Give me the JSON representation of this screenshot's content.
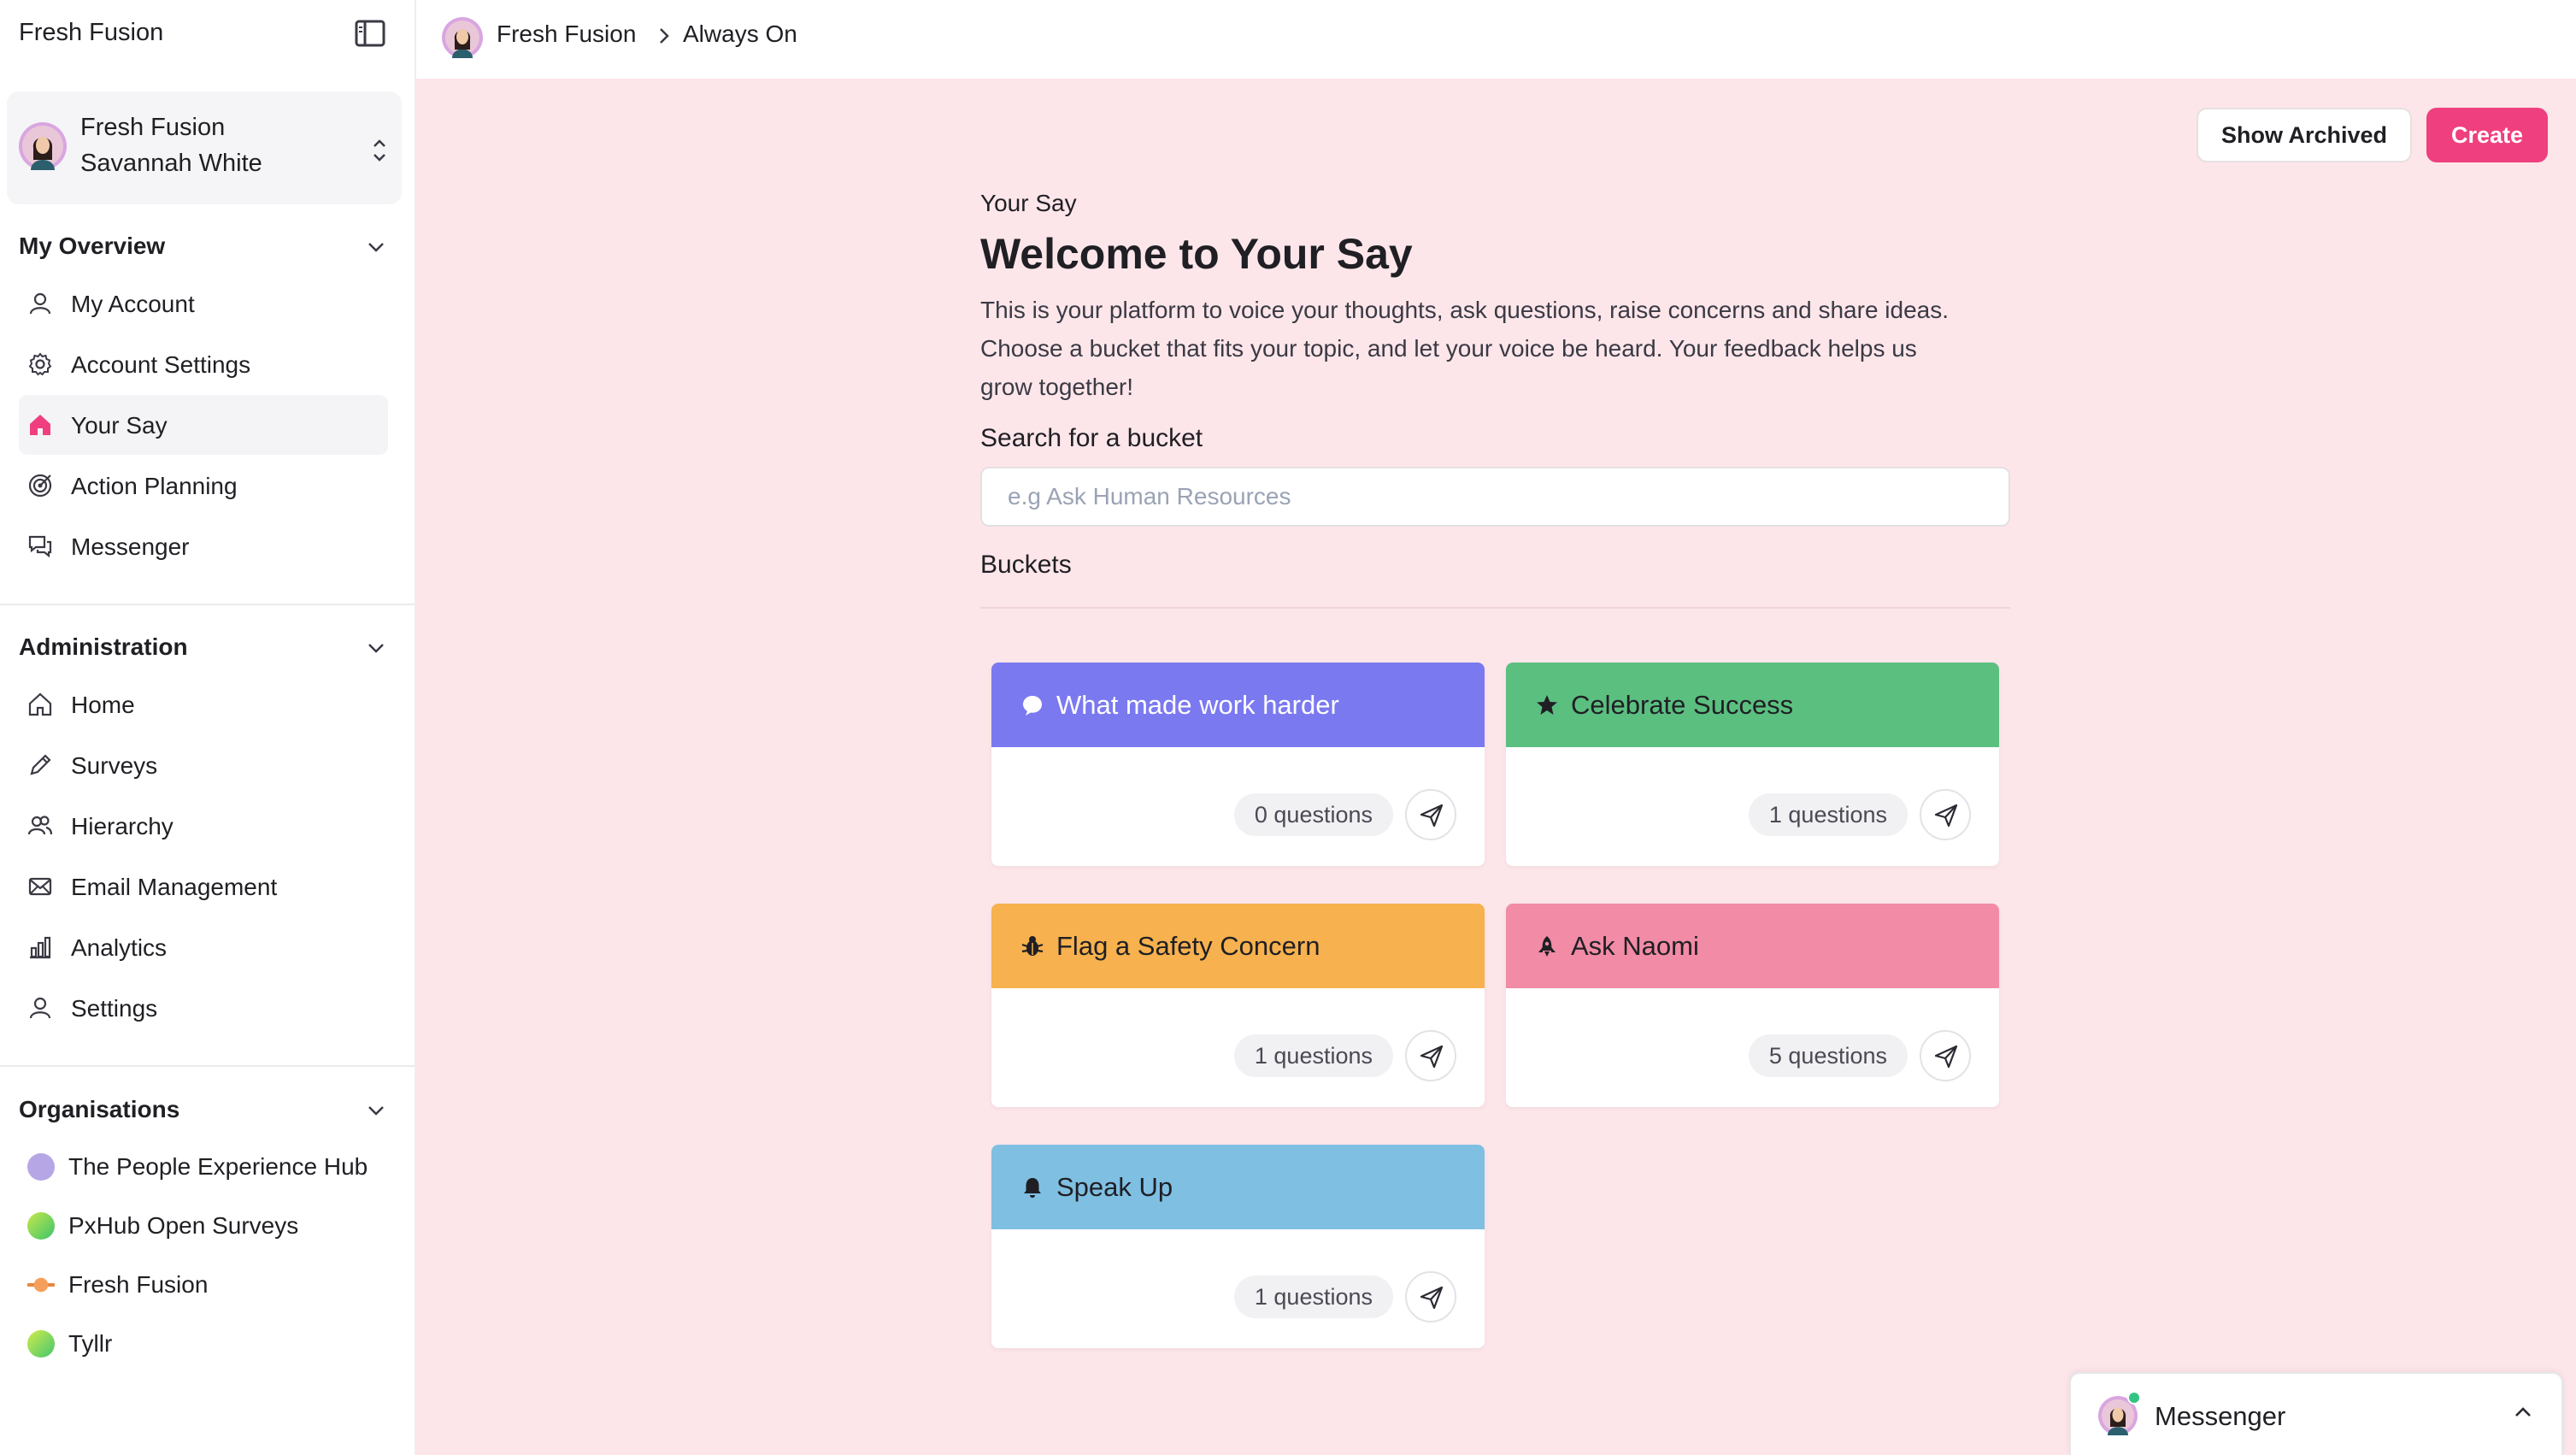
{
  "app": {
    "brand": "Fresh Fusion"
  },
  "switcher": {
    "org": "Fresh Fusion",
    "user": "Savannah White"
  },
  "sidebar": {
    "overview": {
      "title": "My Overview",
      "items": [
        {
          "label": "My Account",
          "icon": "user-icon"
        },
        {
          "label": "Account Settings",
          "icon": "gear-icon"
        },
        {
          "label": "Your Say",
          "icon": "home-icon",
          "active": true
        },
        {
          "label": "Action Planning",
          "icon": "target-icon"
        },
        {
          "label": "Messenger",
          "icon": "chat-icon"
        }
      ]
    },
    "administration": {
      "title": "Administration",
      "items": [
        {
          "label": "Home",
          "icon": "home-icon"
        },
        {
          "label": "Surveys",
          "icon": "pencil-icon"
        },
        {
          "label": "Hierarchy",
          "icon": "users-icon"
        },
        {
          "label": "Email Management",
          "icon": "mail-icon"
        },
        {
          "label": "Analytics",
          "icon": "bar-chart-icon"
        },
        {
          "label": "Settings",
          "icon": "user-cog-icon"
        }
      ]
    },
    "organisations": {
      "title": "Organisations",
      "items": [
        {
          "label": "The People Experience Hub",
          "color": "#b7a6e6"
        },
        {
          "label": "PxHub Open Surveys",
          "color": "#8fd14f"
        },
        {
          "label": "Fresh Fusion",
          "color": "#f5a05a"
        },
        {
          "label": "Tyllr",
          "color": "#9be15d"
        }
      ]
    }
  },
  "breadcrumb": {
    "items": [
      "Fresh Fusion",
      "Always On"
    ]
  },
  "toolbar": {
    "archived_label": "Show Archived",
    "create_label": "Create"
  },
  "page": {
    "eyebrow": "Your Say",
    "title": "Welcome to Your Say",
    "intro_lines": [
      "This is your platform to voice your thoughts, ask questions, raise concerns and share ideas.",
      "Choose a bucket that fits your topic, and let your voice be heard. Your feedback helps us",
      "grow together!"
    ],
    "search_label": "Search for a bucket",
    "search_placeholder": "e.g Ask Human Resources",
    "search_value": "",
    "buckets_label": "Buckets"
  },
  "buckets": [
    {
      "name": "What made work harder",
      "count": "0 questions",
      "color": "#7b79f0",
      "text_color": "#ffffff",
      "icon": "speech-bubble-icon"
    },
    {
      "name": "Celebrate Success",
      "count": "1 questions",
      "color": "#5bbf80",
      "text_color": "#1f1f24",
      "icon": "star-icon"
    },
    {
      "name": "Flag a Safety Concern",
      "count": "1 questions",
      "color": "#f7b14e",
      "text_color": "#1f1f24",
      "icon": "bug-icon"
    },
    {
      "name": "Ask Naomi",
      "count": "5 questions",
      "color": "#f18ba6",
      "text_color": "#1f1f24",
      "icon": "rocket-icon"
    },
    {
      "name": "Speak Up",
      "count": "1 questions",
      "color": "#7fbfe2",
      "text_color": "#1f1f24",
      "icon": "bell-icon"
    }
  ],
  "messenger": {
    "label": "Messenger",
    "status_color": "#33c481"
  }
}
